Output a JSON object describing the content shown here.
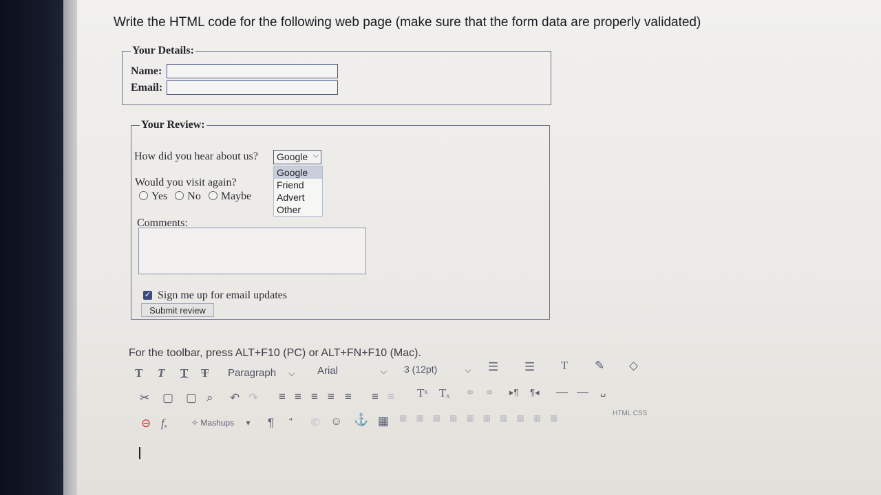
{
  "question": "Write the HTML code for the following web page (make sure that the form data are properly validated)",
  "details": {
    "legend": "Your Details:",
    "name_label": "Name:",
    "email_label": "Email:"
  },
  "review": {
    "legend": "Your Review:",
    "hear_label": "How did you hear about us?",
    "select_value": "Google",
    "options": [
      "Google",
      "Friend",
      "Advert",
      "Other"
    ],
    "visit_label": "Would you visit again?",
    "radios": [
      "Yes",
      "No",
      "Maybe"
    ],
    "comments_label": "Comments:",
    "signup_label": "Sign me up for email updates",
    "submit_label": "Submit review"
  },
  "editor": {
    "hint": "For the toolbar, press ALT+F10 (PC) or ALT+FN+F10 (Mac).",
    "paragraph": "Paragraph",
    "font": "Arial",
    "size": "3 (12pt)",
    "mashups": "Mashups",
    "html_css": "HTML CSS"
  }
}
